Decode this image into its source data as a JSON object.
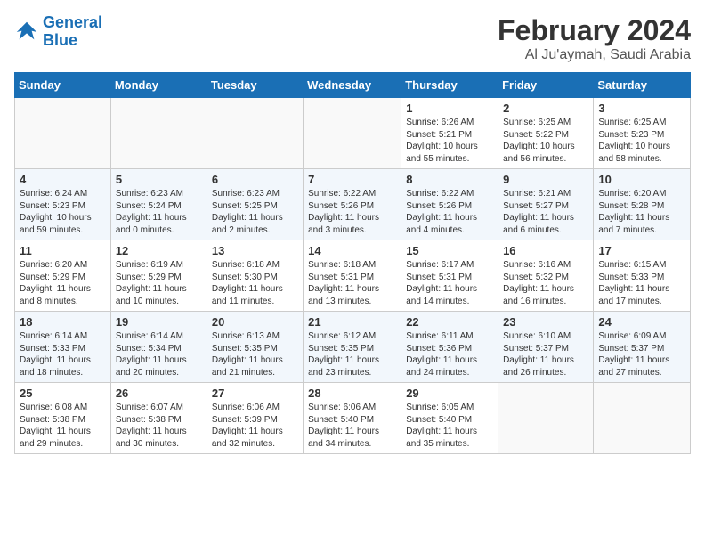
{
  "logo": {
    "line1": "General",
    "line2": "Blue"
  },
  "title": "February 2024",
  "subtitle": "Al Ju'aymah, Saudi Arabia",
  "weekdays": [
    "Sunday",
    "Monday",
    "Tuesday",
    "Wednesday",
    "Thursday",
    "Friday",
    "Saturday"
  ],
  "weeks": [
    [
      {
        "day": "",
        "info": ""
      },
      {
        "day": "",
        "info": ""
      },
      {
        "day": "",
        "info": ""
      },
      {
        "day": "",
        "info": ""
      },
      {
        "day": "1",
        "info": "Sunrise: 6:26 AM\nSunset: 5:21 PM\nDaylight: 10 hours and 55 minutes."
      },
      {
        "day": "2",
        "info": "Sunrise: 6:25 AM\nSunset: 5:22 PM\nDaylight: 10 hours and 56 minutes."
      },
      {
        "day": "3",
        "info": "Sunrise: 6:25 AM\nSunset: 5:23 PM\nDaylight: 10 hours and 58 minutes."
      }
    ],
    [
      {
        "day": "4",
        "info": "Sunrise: 6:24 AM\nSunset: 5:23 PM\nDaylight: 10 hours and 59 minutes."
      },
      {
        "day": "5",
        "info": "Sunrise: 6:23 AM\nSunset: 5:24 PM\nDaylight: 11 hours and 0 minutes."
      },
      {
        "day": "6",
        "info": "Sunrise: 6:23 AM\nSunset: 5:25 PM\nDaylight: 11 hours and 2 minutes."
      },
      {
        "day": "7",
        "info": "Sunrise: 6:22 AM\nSunset: 5:26 PM\nDaylight: 11 hours and 3 minutes."
      },
      {
        "day": "8",
        "info": "Sunrise: 6:22 AM\nSunset: 5:26 PM\nDaylight: 11 hours and 4 minutes."
      },
      {
        "day": "9",
        "info": "Sunrise: 6:21 AM\nSunset: 5:27 PM\nDaylight: 11 hours and 6 minutes."
      },
      {
        "day": "10",
        "info": "Sunrise: 6:20 AM\nSunset: 5:28 PM\nDaylight: 11 hours and 7 minutes."
      }
    ],
    [
      {
        "day": "11",
        "info": "Sunrise: 6:20 AM\nSunset: 5:29 PM\nDaylight: 11 hours and 8 minutes."
      },
      {
        "day": "12",
        "info": "Sunrise: 6:19 AM\nSunset: 5:29 PM\nDaylight: 11 hours and 10 minutes."
      },
      {
        "day": "13",
        "info": "Sunrise: 6:18 AM\nSunset: 5:30 PM\nDaylight: 11 hours and 11 minutes."
      },
      {
        "day": "14",
        "info": "Sunrise: 6:18 AM\nSunset: 5:31 PM\nDaylight: 11 hours and 13 minutes."
      },
      {
        "day": "15",
        "info": "Sunrise: 6:17 AM\nSunset: 5:31 PM\nDaylight: 11 hours and 14 minutes."
      },
      {
        "day": "16",
        "info": "Sunrise: 6:16 AM\nSunset: 5:32 PM\nDaylight: 11 hours and 16 minutes."
      },
      {
        "day": "17",
        "info": "Sunrise: 6:15 AM\nSunset: 5:33 PM\nDaylight: 11 hours and 17 minutes."
      }
    ],
    [
      {
        "day": "18",
        "info": "Sunrise: 6:14 AM\nSunset: 5:33 PM\nDaylight: 11 hours and 18 minutes."
      },
      {
        "day": "19",
        "info": "Sunrise: 6:14 AM\nSunset: 5:34 PM\nDaylight: 11 hours and 20 minutes."
      },
      {
        "day": "20",
        "info": "Sunrise: 6:13 AM\nSunset: 5:35 PM\nDaylight: 11 hours and 21 minutes."
      },
      {
        "day": "21",
        "info": "Sunrise: 6:12 AM\nSunset: 5:35 PM\nDaylight: 11 hours and 23 minutes."
      },
      {
        "day": "22",
        "info": "Sunrise: 6:11 AM\nSunset: 5:36 PM\nDaylight: 11 hours and 24 minutes."
      },
      {
        "day": "23",
        "info": "Sunrise: 6:10 AM\nSunset: 5:37 PM\nDaylight: 11 hours and 26 minutes."
      },
      {
        "day": "24",
        "info": "Sunrise: 6:09 AM\nSunset: 5:37 PM\nDaylight: 11 hours and 27 minutes."
      }
    ],
    [
      {
        "day": "25",
        "info": "Sunrise: 6:08 AM\nSunset: 5:38 PM\nDaylight: 11 hours and 29 minutes."
      },
      {
        "day": "26",
        "info": "Sunrise: 6:07 AM\nSunset: 5:38 PM\nDaylight: 11 hours and 30 minutes."
      },
      {
        "day": "27",
        "info": "Sunrise: 6:06 AM\nSunset: 5:39 PM\nDaylight: 11 hours and 32 minutes."
      },
      {
        "day": "28",
        "info": "Sunrise: 6:06 AM\nSunset: 5:40 PM\nDaylight: 11 hours and 34 minutes."
      },
      {
        "day": "29",
        "info": "Sunrise: 6:05 AM\nSunset: 5:40 PM\nDaylight: 11 hours and 35 minutes."
      },
      {
        "day": "",
        "info": ""
      },
      {
        "day": "",
        "info": ""
      }
    ]
  ]
}
